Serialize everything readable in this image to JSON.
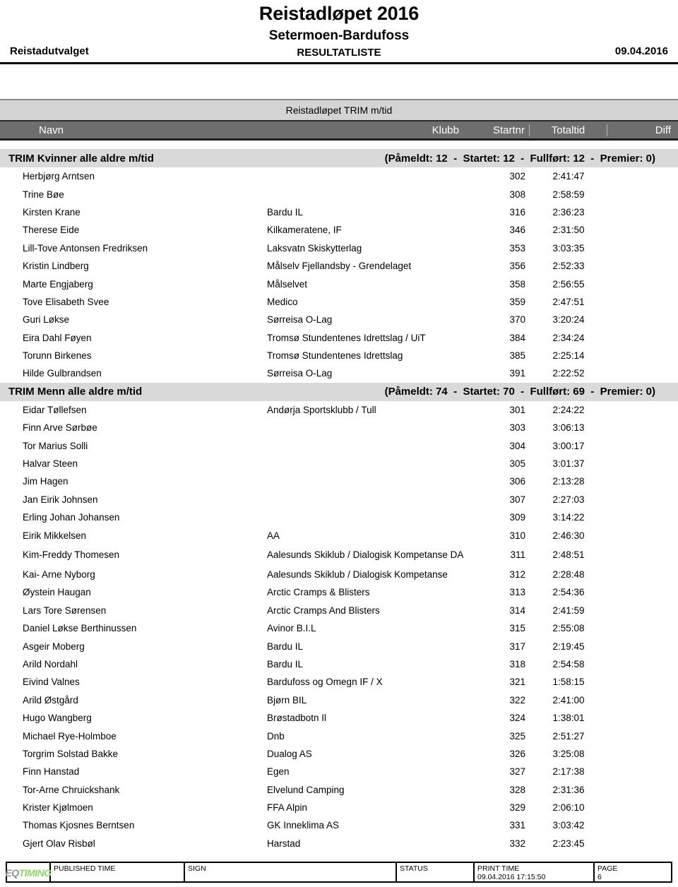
{
  "header": {
    "title": "Reistadløpet 2016",
    "subtitle": "Setermoen-Bardufoss",
    "kind": "RESULTATLISTE",
    "organizer": "Reistadutvalget",
    "date": "09.04.2016"
  },
  "race_band": {
    "label": "Reistadløpet TRIM m/tid"
  },
  "columns": {
    "navn": "Navn",
    "klubb": "Klubb",
    "startnr": "Startnr",
    "totaltid": "Totaltid",
    "diff": "Diff"
  },
  "classes": [
    {
      "name": "TRIM Kvinner alle aldre m/tid",
      "stats": "(Påmeldt: 12  -  Startet: 12  -  Fullført: 12  -  Premier: 0)",
      "counts": {
        "pameldt": 12,
        "startet": 12,
        "fullfort": 12,
        "premier": 0
      },
      "rows": [
        {
          "navn": "Herbjørg Arntsen",
          "klubb": "",
          "startnr": "302",
          "totaltid": "2:41:47",
          "diff": ""
        },
        {
          "navn": "Trine Bøe",
          "klubb": "",
          "startnr": "308",
          "totaltid": "2:58:59",
          "diff": ""
        },
        {
          "navn": "Kirsten Krane",
          "klubb": "Bardu IL",
          "startnr": "316",
          "totaltid": "2:36:23",
          "diff": ""
        },
        {
          "navn": "Therese Eide",
          "klubb": "Kilkameratene, IF",
          "startnr": "346",
          "totaltid": "2:31:50",
          "diff": ""
        },
        {
          "navn": "Lill-Tove Antonsen Fredriksen",
          "klubb": "Laksvatn Skiskytterlag",
          "startnr": "353",
          "totaltid": "3:03:35",
          "diff": ""
        },
        {
          "navn": "Kristin Lindberg",
          "klubb": "Målselv Fjellandsby - Grendelaget",
          "startnr": "356",
          "totaltid": "2:52:33",
          "diff": ""
        },
        {
          "navn": "Marte Engjaberg",
          "klubb": "Målselvet",
          "startnr": "358",
          "totaltid": "2:56:55",
          "diff": ""
        },
        {
          "navn": "Tove Elisabeth Svee",
          "klubb": "Medico",
          "startnr": "359",
          "totaltid": "2:47:51",
          "diff": ""
        },
        {
          "navn": "Guri Løkse",
          "klubb": "Sørreisa O-Lag",
          "startnr": "370",
          "totaltid": "3:20:24",
          "diff": ""
        },
        {
          "navn": "Eira Dahl Føyen",
          "klubb": "Tromsø Stundentenes Idrettslag / UiT",
          "startnr": "384",
          "totaltid": "2:34:24",
          "diff": ""
        },
        {
          "navn": "Torunn Birkenes",
          "klubb": "Tromsø Stundentenes Idrettslag",
          "startnr": "385",
          "totaltid": "2:25:14",
          "diff": ""
        },
        {
          "navn": "Hilde Gulbrandsen",
          "klubb": "Sørreisa O-Lag",
          "startnr": "391",
          "totaltid": "2:22:52",
          "diff": ""
        }
      ]
    },
    {
      "name": "TRIM Menn alle aldre m/tid",
      "stats": "(Påmeldt: 74  -  Startet: 70  -  Fullført: 69  -  Premier: 0)",
      "counts": {
        "pameldt": 74,
        "startet": 70,
        "fullfort": 69,
        "premier": 0
      },
      "rows": [
        {
          "navn": "Eidar Tøllefsen",
          "klubb": "Andørja Sportsklubb / Tull",
          "startnr": "301",
          "totaltid": "2:24:22",
          "diff": ""
        },
        {
          "navn": "Finn Arve Sørbøe",
          "klubb": "",
          "startnr": "303",
          "totaltid": "3:06:13",
          "diff": ""
        },
        {
          "navn": "Tor Marius Solli",
          "klubb": "",
          "startnr": "304",
          "totaltid": "3:00:17",
          "diff": ""
        },
        {
          "navn": "Halvar Steen",
          "klubb": "",
          "startnr": "305",
          "totaltid": "3:01:37",
          "diff": ""
        },
        {
          "navn": "Jim Hagen",
          "klubb": "",
          "startnr": "306",
          "totaltid": "2:13:28",
          "diff": ""
        },
        {
          "navn": "Jan Eirik Johnsen",
          "klubb": "",
          "startnr": "307",
          "totaltid": "2:27:03",
          "diff": ""
        },
        {
          "navn": "Erling Johan Johansen",
          "klubb": "",
          "startnr": "309",
          "totaltid": "3:14:22",
          "diff": ""
        },
        {
          "navn": "Eirik Mikkelsen",
          "klubb": "AA",
          "startnr": "310",
          "totaltid": "2:46:30",
          "diff": ""
        },
        {
          "navn": "Kim-Freddy Thomesen",
          "klubb": "Aalesunds Skiklub / Dialogisk Kompetanse DA",
          "startnr": "311",
          "totaltid": "2:48:51",
          "diff": "",
          "tall": true
        },
        {
          "navn": "Kai- Arne Nyborg",
          "klubb": "Aalesunds Skiklub / Dialogisk Kompetanse",
          "startnr": "312",
          "totaltid": "2:28:48",
          "diff": ""
        },
        {
          "navn": "Øystein Haugan",
          "klubb": "Arctic Cramps & Blisters",
          "startnr": "313",
          "totaltid": "2:54:36",
          "diff": ""
        },
        {
          "navn": "Lars Tore Sørensen",
          "klubb": "Arctic Cramps And Blisters",
          "startnr": "314",
          "totaltid": "2:41:59",
          "diff": ""
        },
        {
          "navn": "Daniel Løkse Berthinussen",
          "klubb": "Avinor B.I.L",
          "startnr": "315",
          "totaltid": "2:55:08",
          "diff": ""
        },
        {
          "navn": "Asgeir Moberg",
          "klubb": "Bardu IL",
          "startnr": "317",
          "totaltid": "2:19:45",
          "diff": ""
        },
        {
          "navn": "Arild Nordahl",
          "klubb": "Bardu IL",
          "startnr": "318",
          "totaltid": "2:54:58",
          "diff": ""
        },
        {
          "navn": "Eivind Valnes",
          "klubb": "Bardufoss og Omegn IF / X",
          "startnr": "321",
          "totaltid": "1:58:15",
          "diff": ""
        },
        {
          "navn": "Arild Østgård",
          "klubb": "Bjørn BIL",
          "startnr": "322",
          "totaltid": "2:41:00",
          "diff": ""
        },
        {
          "navn": "Hugo Wangberg",
          "klubb": "Brøstadbotn Il",
          "startnr": "324",
          "totaltid": "1:38:01",
          "diff": ""
        },
        {
          "navn": "Michael Rye-Holmboe",
          "klubb": "Dnb",
          "startnr": "325",
          "totaltid": "2:51:27",
          "diff": ""
        },
        {
          "navn": "Torgrim Solstad Bakke",
          "klubb": "Dualog AS",
          "startnr": "326",
          "totaltid": "3:25:08",
          "diff": ""
        },
        {
          "navn": "Finn Hanstad",
          "klubb": "Egen",
          "startnr": "327",
          "totaltid": "2:17:38",
          "diff": ""
        },
        {
          "navn": "Tor-Arne Chruickshank",
          "klubb": "Elvelund Camping",
          "startnr": "328",
          "totaltid": "2:31:36",
          "diff": ""
        },
        {
          "navn": "Krister Kjølmoen",
          "klubb": "FFA Alpin",
          "startnr": "329",
          "totaltid": "2:06:10",
          "diff": ""
        },
        {
          "navn": "Thomas Kjosnes Berntsen",
          "klubb": "GK Inneklima AS",
          "startnr": "331",
          "totaltid": "3:03:42",
          "diff": ""
        },
        {
          "navn": "Gjert Olav Risbøl",
          "klubb": "Harstad",
          "startnr": "332",
          "totaltid": "2:23:45",
          "diff": ""
        }
      ]
    }
  ],
  "footer": {
    "logo_eq": "EQ",
    "logo_timing": "TIMING",
    "published_time_label": "PUBLISHED TIME",
    "published_time_value": "",
    "sign_label": "SIGN",
    "sign_value": "",
    "status_label": "STATUS",
    "status_value": "",
    "print_time_label": "PRINT TIME",
    "print_time_value": "09.04.2016 17:15:50",
    "page_label": "PAGE",
    "page_value": "6"
  },
  "colors": {
    "band_bg": "#d4d4d4",
    "colhead_bg": "#6e6e6e",
    "class_bg": "#d9d9d9",
    "logo_green": "#8fd46a",
    "logo_gray": "#8f8f8f"
  }
}
